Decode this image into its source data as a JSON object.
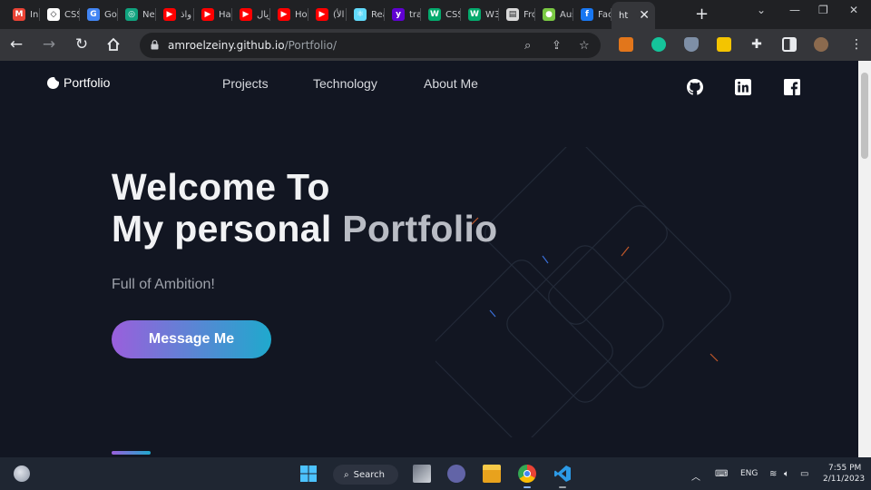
{
  "browser": {
    "tabs": [
      {
        "label": "Inb",
        "icon": "gmail-icon",
        "color": "#ea4335"
      },
      {
        "label": "CSS",
        "icon": "codepen-icon",
        "color": "#ffffff"
      },
      {
        "label": "Go",
        "icon": "google-translate-icon",
        "color": "#4285f4"
      },
      {
        "label": "Ne",
        "icon": "chatgpt-icon",
        "color": "#10a37f"
      },
      {
        "label": "واذ",
        "icon": "youtube-icon",
        "color": "#ff0000"
      },
      {
        "label": "Har",
        "icon": "youtube-icon",
        "color": "#ff0000"
      },
      {
        "label": "ريال",
        "icon": "youtube-icon",
        "color": "#ff0000"
      },
      {
        "label": "Ho",
        "icon": "youtube-icon",
        "color": "#ff0000"
      },
      {
        "label": "(الأ",
        "icon": "youtube-icon",
        "color": "#ff0000"
      },
      {
        "label": "Rea",
        "icon": "react-icon",
        "color": "#61dafb"
      },
      {
        "label": "trar",
        "icon": "yahoo-icon",
        "color": "#6001d2"
      },
      {
        "label": "CSS",
        "icon": "w3schools-icon",
        "color": "#04aa6d"
      },
      {
        "label": "W3",
        "icon": "w3schools-icon",
        "color": "#04aa6d"
      },
      {
        "label": "Fro",
        "icon": "document-icon",
        "color": "#d9d9d9"
      },
      {
        "label": "Aus",
        "icon": "green-circle-icon",
        "color": "#7ac943"
      },
      {
        "label": "Fac",
        "icon": "facebook-icon",
        "color": "#1877f2"
      },
      {
        "label": "ht",
        "icon": "",
        "color": "#35363a"
      }
    ],
    "address": {
      "domain": "amroelzeiny.github.io",
      "path": "/Portfolio/"
    }
  },
  "site": {
    "brand": "Portfolio",
    "nav": [
      "Projects",
      "Technology",
      "About Me"
    ],
    "social": [
      "github-icon",
      "linkedin-icon",
      "facebook-icon"
    ],
    "hero": {
      "line1": "Welcome To",
      "line2_bold": "My personal",
      "line2_light": "Portfolio",
      "subtitle": "Full of Ambition!",
      "cta": "Message Me"
    },
    "colors": {
      "background": "#121622",
      "gradient_start": "#9a5fdc",
      "gradient_end": "#1fa9cd"
    }
  },
  "taskbar": {
    "search_label": "Search",
    "language": "ENG",
    "time": "7:55 PM",
    "date": "2/11/2023"
  }
}
